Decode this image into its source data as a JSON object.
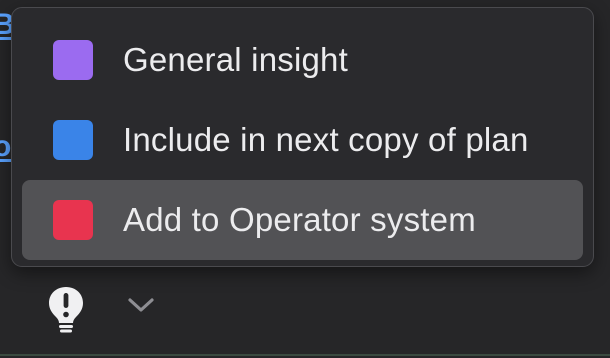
{
  "background_links": [
    {
      "text": "B"
    },
    {
      "text": "o"
    }
  ],
  "menu": {
    "items": [
      {
        "label": "General insight",
        "color": "#9b6bf0",
        "highlighted": false
      },
      {
        "label": "Include in next copy of plan",
        "color": "#3a84e8",
        "highlighted": false
      },
      {
        "label": "Add to Operator system",
        "color": "#e8344f",
        "highlighted": true
      }
    ],
    "highlight_color": "#525255"
  },
  "toolbar": {
    "icons": [
      "lightbulb-exclamation-icon",
      "chevron-down-icon"
    ]
  }
}
